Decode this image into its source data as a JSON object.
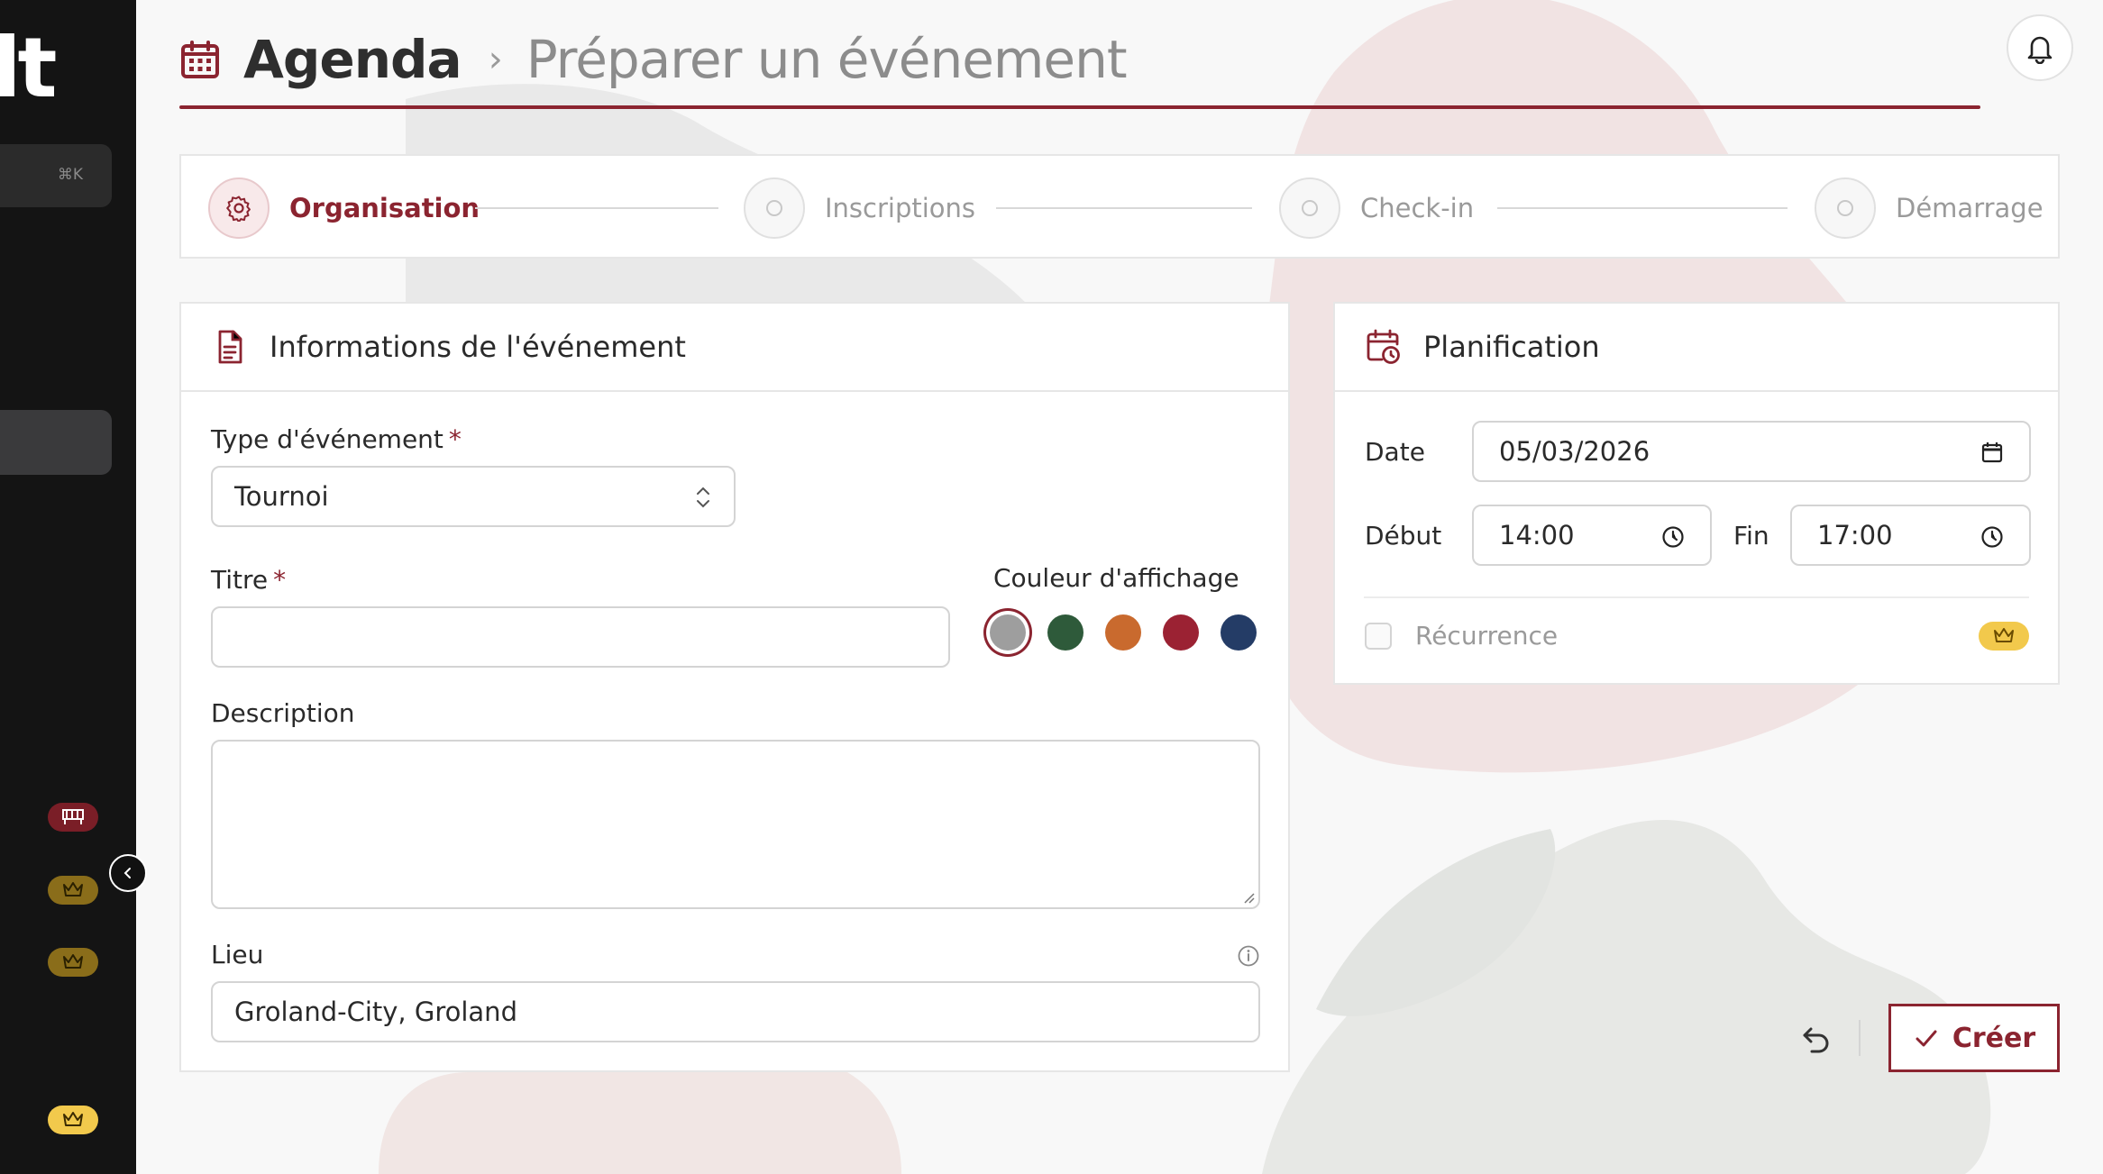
{
  "sidebar": {
    "logo_text": "lt",
    "search_shortcut": "⌘K",
    "badges": [
      {
        "name": "flag-badge",
        "color": "#7a1e27"
      },
      {
        "name": "crown-badge-1",
        "color": "#8a6d1a"
      },
      {
        "name": "crown-badge-2",
        "color": "#8a6d1a"
      },
      {
        "name": "crown-badge-3",
        "color": "#f2c94c"
      }
    ]
  },
  "header": {
    "title": "Agenda",
    "separator": "›",
    "subtitle": "Préparer un événement"
  },
  "stepper": {
    "steps": [
      {
        "label": "Organisation",
        "active": true
      },
      {
        "label": "Inscriptions",
        "active": false
      },
      {
        "label": "Check-in",
        "active": false
      },
      {
        "label": "Démarrage",
        "active": false
      }
    ]
  },
  "event_info": {
    "title": "Informations de l'événement",
    "type_label": "Type d'événement",
    "type_value": "Tournoi",
    "title_label": "Titre",
    "title_value": "",
    "color_label": "Couleur d'affichage",
    "colors": [
      "#9e9e9e",
      "#2e5a3a",
      "#c96a2e",
      "#9b2233",
      "#243c66"
    ],
    "selected_color_index": 0,
    "description_label": "Description",
    "description_value": "",
    "location_label": "Lieu",
    "location_value": "Groland-City, Groland",
    "required_mark": "*"
  },
  "planning": {
    "title": "Planification",
    "date_label": "Date",
    "date_value": "05/03/2026",
    "start_label": "Début",
    "start_value": "14:00",
    "end_label": "Fin",
    "end_value": "17:00",
    "recurrence_label": "Récurrence"
  },
  "actions": {
    "create_label": "Créer"
  },
  "colors": {
    "accent": "#8b2430",
    "premium": "#f2c94c",
    "sidebar_bg": "#141414"
  }
}
